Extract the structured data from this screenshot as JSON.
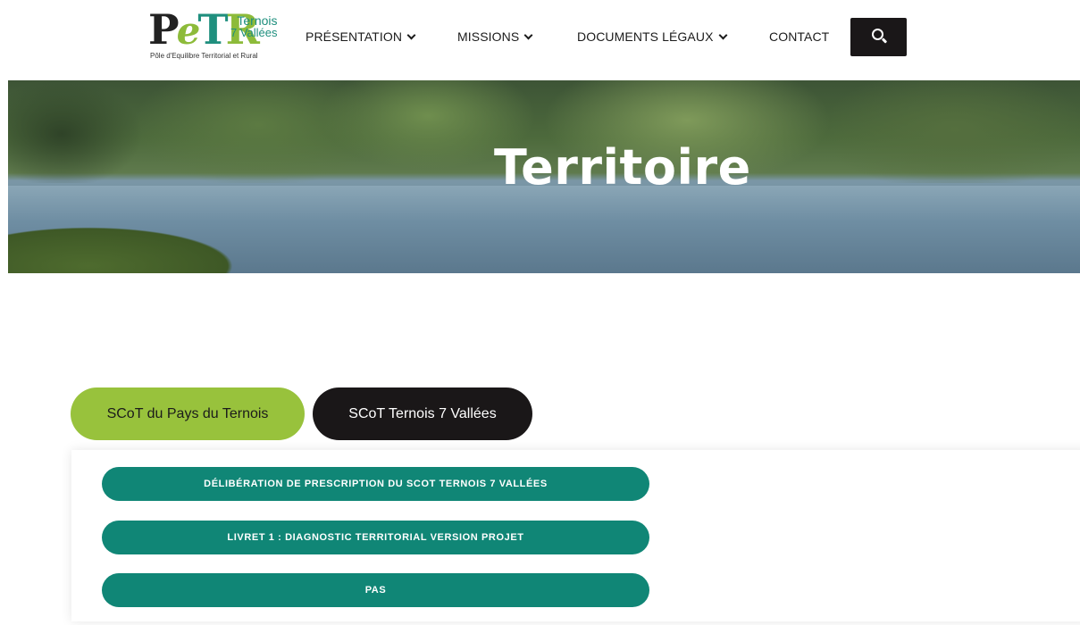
{
  "header": {
    "logo": {
      "mark": [
        "P",
        "e",
        "T",
        "R"
      ],
      "line1": "Ternois",
      "line2": "7 Vallées",
      "tagline": "Pôle d'Equilibre Territorial et Rural"
    },
    "nav": [
      {
        "label": "PRÉSENTATION",
        "has_dropdown": true
      },
      {
        "label": "MISSIONS",
        "has_dropdown": true
      },
      {
        "label": "DOCUMENTS LÉGAUX",
        "has_dropdown": true
      },
      {
        "label": "CONTACT",
        "has_dropdown": false
      }
    ],
    "search_icon": "search-icon"
  },
  "hero": {
    "title": "Territoire"
  },
  "tabs": [
    {
      "label": "SCoT du Pays du Ternois",
      "active": false,
      "color": "#98c23c"
    },
    {
      "label": "SCoT Ternois 7 Vallées",
      "active": true,
      "color": "#1a1718"
    }
  ],
  "documents": [
    {
      "label": "DÉLIBÉRATION DE PRESCRIPTION DU SCOT TERNOIS 7 VALLÉES"
    },
    {
      "label": "LIVRET 1 : DIAGNOSTIC TERRITORIAL VERSION PROJET"
    },
    {
      "label": "PAS"
    }
  ],
  "colors": {
    "accent_green": "#98c23c",
    "teal": "#108676",
    "dark": "#1a1718"
  }
}
